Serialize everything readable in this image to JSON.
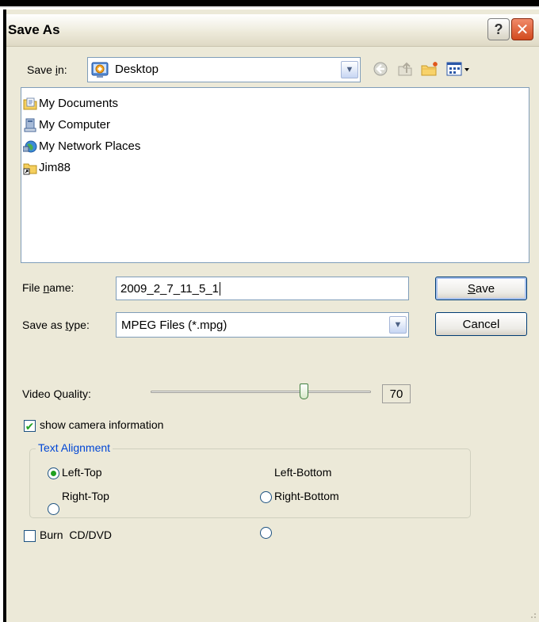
{
  "dialog": {
    "title": "Save As",
    "help_glyph": "?",
    "close_glyph": "✕"
  },
  "save_in": {
    "label_prefix": "Save ",
    "label_hotkey": "i",
    "label_suffix": "n:",
    "value": "Desktop",
    "value_icon": "desktop-icon"
  },
  "toolbar": {
    "icons": [
      "back-icon",
      "up-folder-icon",
      "new-folder-icon",
      "views-menu-icon"
    ]
  },
  "files": [
    {
      "name": "My Documents",
      "icon": "my-documents-icon"
    },
    {
      "name": "My Computer",
      "icon": "my-computer-icon"
    },
    {
      "name": "My Network Places",
      "icon": "network-places-icon"
    },
    {
      "name": "Jim88",
      "icon": "folder-shortcut-icon"
    }
  ],
  "file_name": {
    "label_prefix": "File ",
    "label_hotkey": "n",
    "label_suffix": "ame:",
    "value": "2009_2_7_11_5_1"
  },
  "save_type": {
    "label_prefix": "Save as ",
    "label_hotkey": "t",
    "label_suffix": "ype:",
    "value": "MPEG Files (*.mpg)"
  },
  "buttons": {
    "save_hotkey": "S",
    "save_rest": "ave",
    "cancel": "Cancel"
  },
  "video_quality": {
    "label": "Video Quality:",
    "value": "70",
    "min": 0,
    "max": 100,
    "level": 70
  },
  "show_camera": {
    "label": "show camera information",
    "checked": true
  },
  "text_alignment": {
    "legend": "Text Alignment",
    "options": [
      {
        "label": "Left-Top",
        "selected": true
      },
      {
        "label": "Right-Top",
        "selected": false
      },
      {
        "label": "Left-Bottom",
        "selected": false
      },
      {
        "label": "Right-Bottom",
        "selected": false
      }
    ]
  },
  "burn": {
    "label": "Burn  CD/DVD",
    "checked": false
  },
  "colors": {
    "dialog_bg": "#ece9d8",
    "accent_green": "#21a121",
    "group_label": "#0046d5",
    "close_red": "#d24a1e"
  }
}
